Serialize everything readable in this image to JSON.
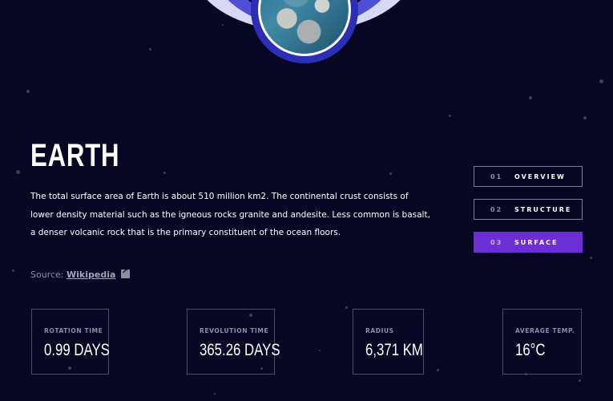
{
  "planet": {
    "name": "EARTH",
    "description": "The total surface area of Earth is about 510 million km2. The continental crust consists of lower density material such as the igneous rocks granite and andesite. Less common is basalt, a denser volcanic rock that is the primary constituent of the ocean floors.",
    "source_label": "Source:",
    "source_link": "Wikipedia"
  },
  "tabs": [
    {
      "num": "01",
      "label": "OVERVIEW",
      "active": false
    },
    {
      "num": "02",
      "label": "STRUCTURE",
      "active": false
    },
    {
      "num": "03",
      "label": "SURFACE",
      "active": true
    }
  ],
  "stats": [
    {
      "label": "ROTATION TIME",
      "value": "0.99 DAYS"
    },
    {
      "label": "REVOLUTION TIME",
      "value": "365.26 DAYS"
    },
    {
      "label": "RADIUS",
      "value": "6,371 KM"
    },
    {
      "label": "AVERAGE TEMP.",
      "value": "16°C"
    }
  ],
  "colors": {
    "background": "#070724",
    "accent": "#6d2ed5",
    "muted": "#8c8da0"
  }
}
